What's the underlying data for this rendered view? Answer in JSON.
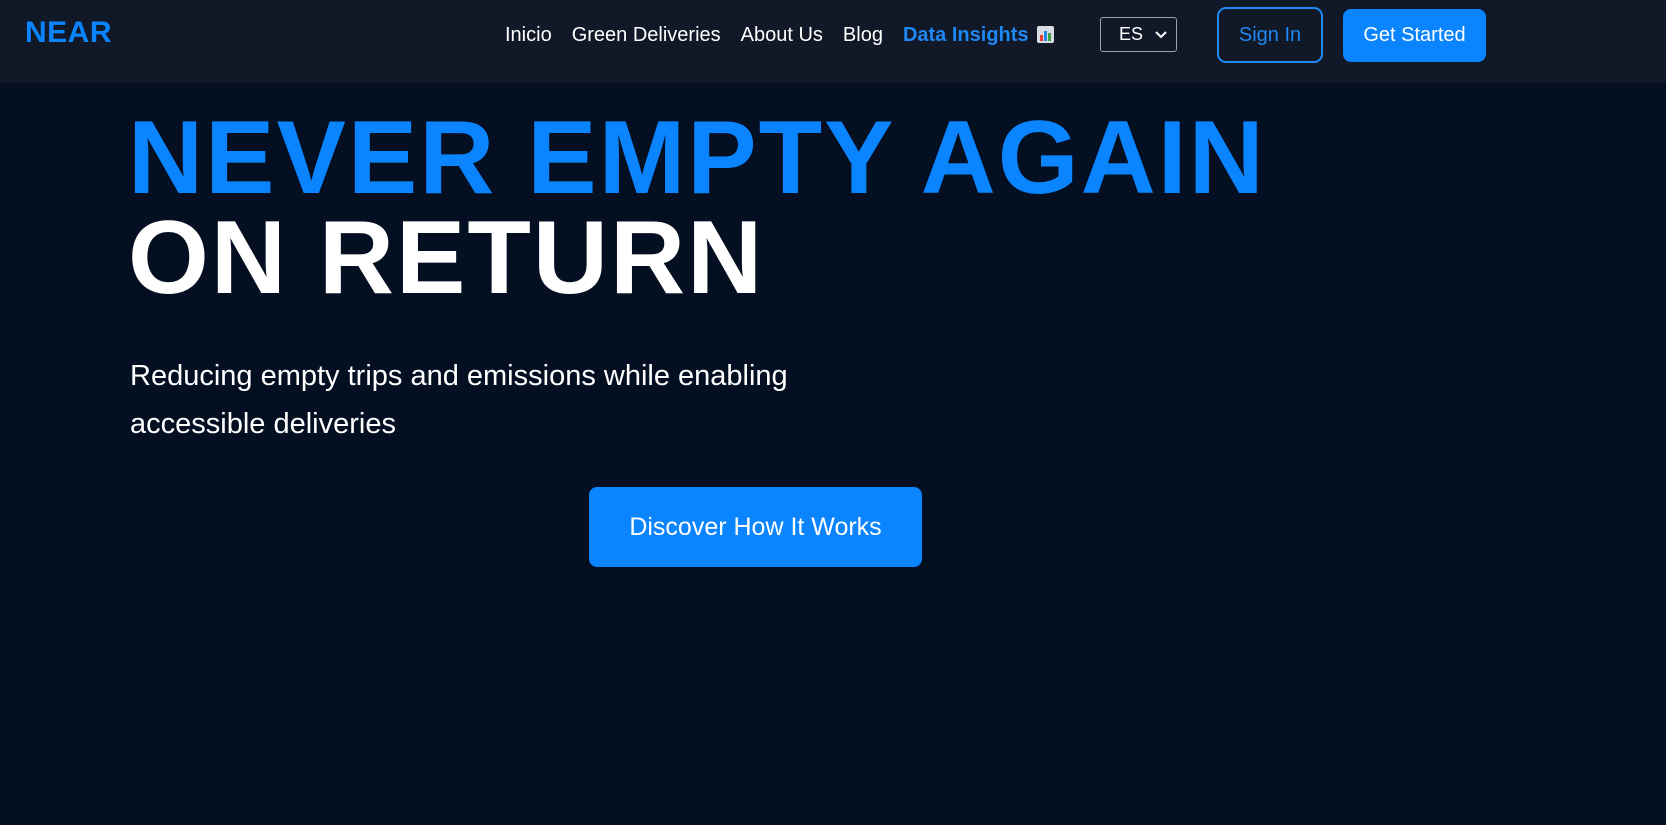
{
  "navbar": {
    "logo": "NEAR",
    "links": [
      {
        "label": "Inicio"
      },
      {
        "label": "Green Deliveries"
      },
      {
        "label": "About Us"
      },
      {
        "label": "Blog"
      },
      {
        "label": "Data Insights",
        "active": true,
        "icon": "bar-chart-icon"
      }
    ],
    "language": {
      "selected": "ES"
    },
    "signin_label": "Sign In",
    "get_started_label": "Get Started"
  },
  "hero": {
    "title_line1": "NEVER EMPTY AGAIN",
    "title_line2": "ON RETURN",
    "subtitle": "Reducing empty trips and emissions while enabling accessible deliveries",
    "cta_label": "Discover How It Works"
  },
  "colors": {
    "page_background": "#050f22",
    "navbar_background": "#111827",
    "accent": "#0a84ff",
    "text": "#ffffff"
  }
}
